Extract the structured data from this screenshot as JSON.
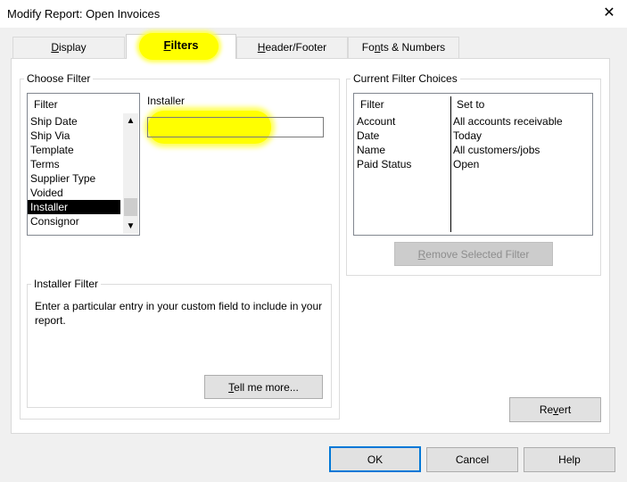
{
  "window": {
    "title": "Modify Report: Open Invoices",
    "close_glyph": "✕"
  },
  "tabs": [
    {
      "label_pre": "",
      "mnemonic": "D",
      "label_post": "isplay"
    },
    {
      "label_pre": "",
      "mnemonic": "F",
      "label_post": "ilters"
    },
    {
      "label_pre": "",
      "mnemonic": "H",
      "label_post": "eader/Footer"
    },
    {
      "label_pre": "Fo",
      "mnemonic": "n",
      "label_post": "ts & Numbers"
    }
  ],
  "choose_filter": {
    "group_label": "Choose Filter",
    "list_header": "Filter",
    "items": [
      "Ship Date",
      "Ship Via",
      "Template",
      "Terms",
      "Supplier Type",
      "Voided",
      "Installer",
      "Consignor"
    ],
    "selected": "Installer",
    "field_label": "Installer",
    "field_value": ""
  },
  "installer_filter": {
    "group_label": "Installer Filter",
    "description": "Enter a particular entry in your custom field to include in your report.",
    "tell_me_more": {
      "mnemonic": "T",
      "label_post": "ell me more..."
    }
  },
  "current_filter_choices": {
    "group_label": "Current Filter Choices",
    "col_filter": "Filter",
    "col_set_to": "Set to",
    "rows": [
      {
        "filter": "Account",
        "set_to": "All accounts receivable"
      },
      {
        "filter": "Date",
        "set_to": "Today"
      },
      {
        "filter": "Name",
        "set_to": "All customers/jobs"
      },
      {
        "filter": "Paid Status",
        "set_to": "Open"
      }
    ],
    "remove_button": {
      "mnemonic": "R",
      "label_post": "emove Selected Filter"
    }
  },
  "revert_button": {
    "label_pre": "Re",
    "mnemonic": "v",
    "label_post": "ert"
  },
  "footer": {
    "ok": "OK",
    "cancel": "Cancel",
    "help": "Help"
  },
  "colors": {
    "highlight": "#ffff00",
    "selection": "#000000",
    "default_button_border": "#0078d7"
  }
}
